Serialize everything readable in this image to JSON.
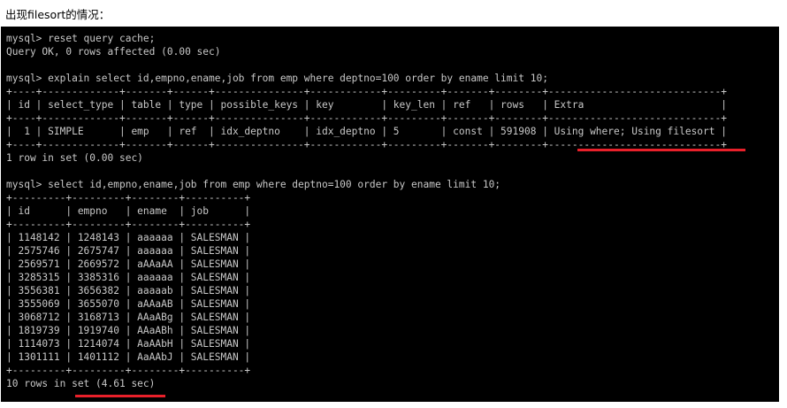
{
  "caption": "出现filesort的情况：",
  "terminal": {
    "lines": [
      "mysql> reset query cache;",
      "Query OK, 0 rows affected (0.00 sec)",
      "",
      "mysql> explain select id,empno,ename,job from emp where deptno=100 order by ename limit 10;",
      "+----+-------------+-------+------+---------------+------------+---------+-------+--------+-----------------------------+",
      "| id | select_type | table | type | possible_keys | key        | key_len | ref   | rows   | Extra                       |",
      "+----+-------------+-------+------+---------------+------------+---------+-------+--------+-----------------------------+",
      "|  1 | SIMPLE      | emp   | ref  | idx_deptno    | idx_deptno | 5       | const | 591908 | Using where; Using filesort |",
      "+----+-------------+-------+------+---------------+------------+---------+-------+--------+-----------------------------+",
      "1 row in set (0.00 sec)",
      "",
      "mysql> select id,empno,ename,job from emp where deptno=100 order by ename limit 10;",
      "+---------+---------+--------+----------+",
      "| id      | empno   | ename  | job      |",
      "+---------+---------+--------+----------+",
      "| 1148142 | 1248143 | aaaaaa | SALESMAN |",
      "| 2575746 | 2675747 | aaaaaa | SALESMAN |",
      "| 2569571 | 2669572 | aAAaAA | SALESMAN |",
      "| 3285315 | 3385316 | aaaaaa | SALESMAN |",
      "| 3556381 | 3656382 | aaaaab | SALESMAN |",
      "| 3555069 | 3655070 | aAAaAB | SALESMAN |",
      "| 3068712 | 3168713 | AAaABg | SALESMAN |",
      "| 1819739 | 1919740 | AAaABh | SALESMAN |",
      "| 1114073 | 1214074 | AaAAbH | SALESMAN |",
      "| 1301111 | 1401112 | AaAAbJ | SALESMAN |",
      "+---------+---------+--------+----------+",
      "10 rows in set (4.61 sec)"
    ]
  },
  "colors": {
    "terminal_bg": "#000000",
    "terminal_text": "#c8c8c8",
    "highlight_underline": "#e8202a"
  }
}
